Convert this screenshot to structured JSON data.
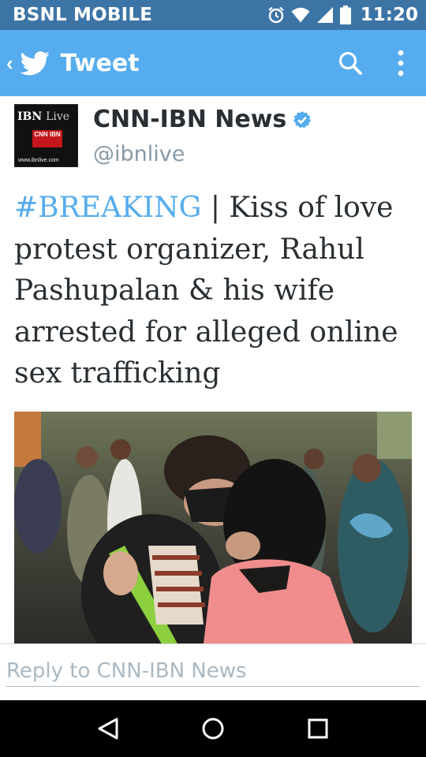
{
  "status_bar": {
    "carrier": "BSNL MOBILE",
    "time": "11:20",
    "icons": [
      "alarm-icon",
      "wifi-icon",
      "signal-icon",
      "battery-icon"
    ]
  },
  "action_bar": {
    "title": "Tweet",
    "back_icon": "chevron-left-icon",
    "logo_icon": "twitter-bird-icon",
    "actions": [
      "search-icon",
      "overflow-menu-icon"
    ],
    "background": "#55acee"
  },
  "tweet": {
    "author_name": "CNN-IBN News",
    "author_handle": "@ibnlive",
    "verified": true,
    "avatar": {
      "brand": "IBN",
      "brand_suffix": "Live",
      "badge": "CNN IBN",
      "url": "www.ibnlive.com"
    },
    "hashtag": "#BREAKING",
    "text": " | Kiss of love protest organizer, Rahul Pashupalan & his wife arrested for alleged online sex trafficking",
    "photo_icon": "protest-photo"
  },
  "reply": {
    "placeholder": "Reply to CNN-IBN News"
  },
  "nav_bar": {
    "buttons": [
      "back-triangle-icon",
      "home-circle-icon",
      "recents-square-icon"
    ]
  },
  "colors": {
    "status_bar": "#3d74a6",
    "accent": "#55acee",
    "text": "#292f33",
    "secondary_text": "#8899a6"
  }
}
